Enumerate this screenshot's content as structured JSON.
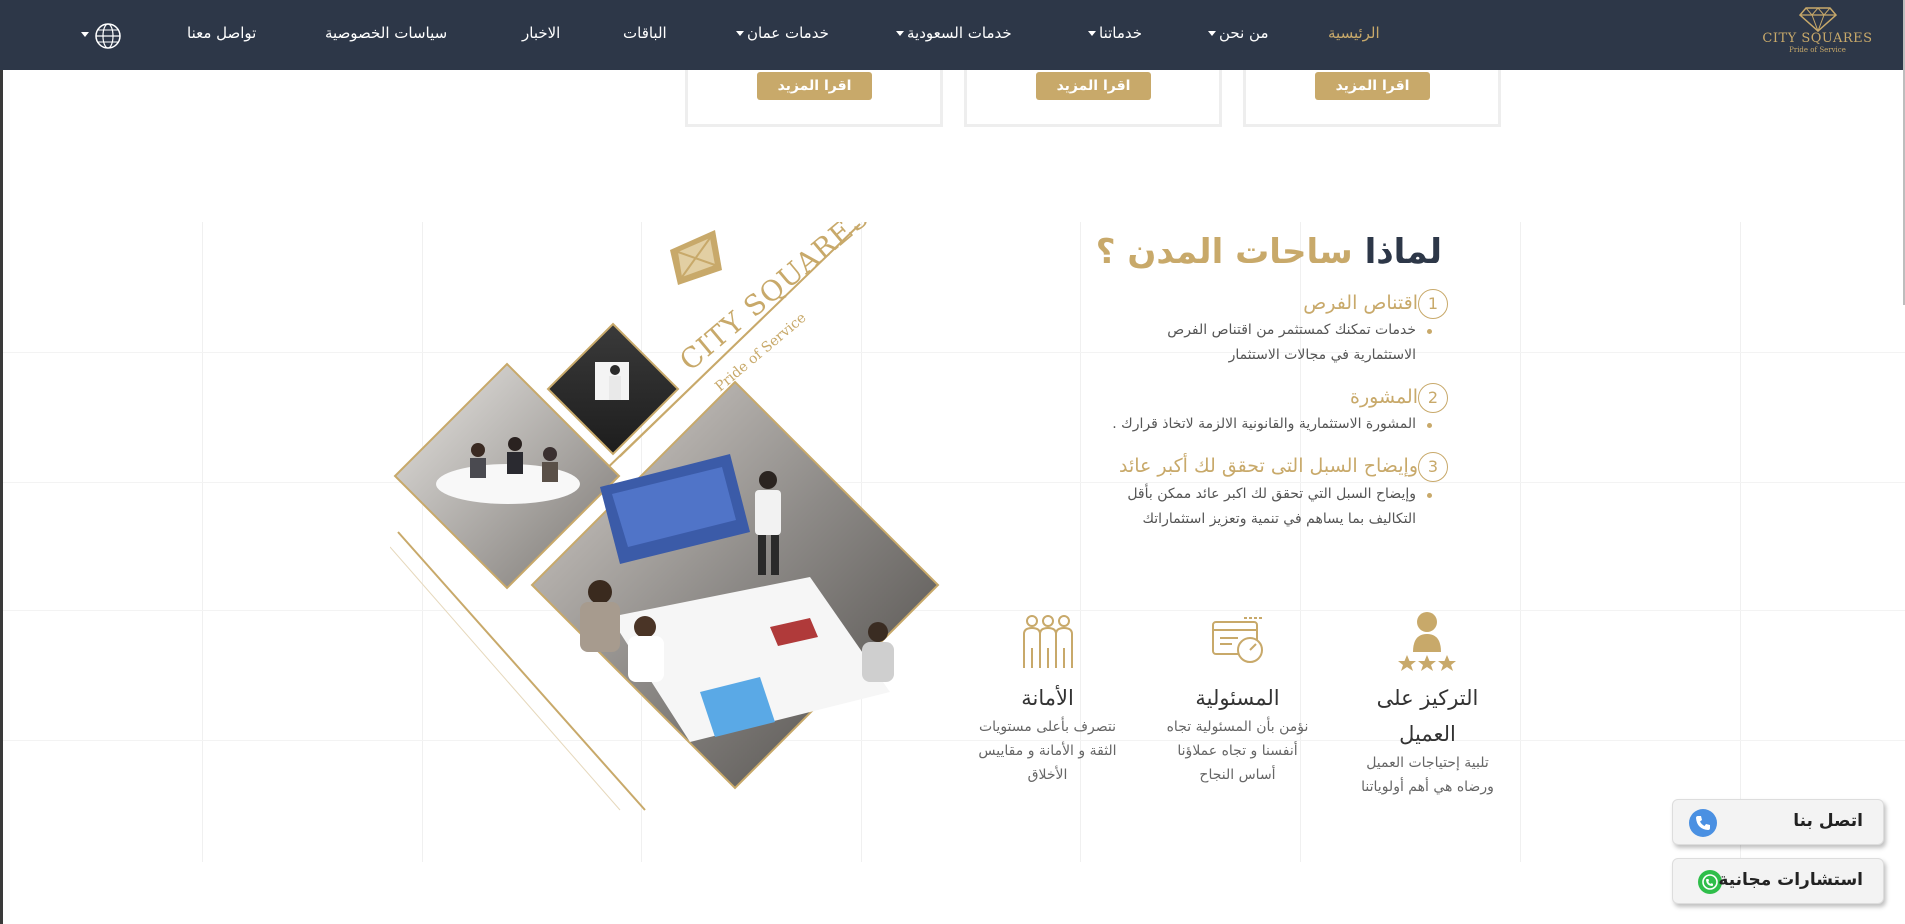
{
  "brand": {
    "logo_title": "CITY SQUARES",
    "logo_subtitle": "Pride of Service",
    "gold": "#c8a96a",
    "navy": "#2d3748"
  },
  "nav": {
    "items": [
      {
        "label": "الرئيسية",
        "active": true
      },
      {
        "label": "من نحن",
        "dropdown": true
      },
      {
        "label": "خدماتنا",
        "dropdown": true
      },
      {
        "label": "خدمات السعودية",
        "dropdown": true
      },
      {
        "label": "خدمات عمان",
        "dropdown": true
      },
      {
        "label": "الباقات"
      },
      {
        "label": "الاخبار"
      },
      {
        "label": "سياسات الخصوصية"
      },
      {
        "label": "تواصل معنا"
      }
    ],
    "language_icon": "globe-icon"
  },
  "cards": {
    "read_more": "اقرا المزيد"
  },
  "why": {
    "title_prefix": "لماذا",
    "title_highlight": "ساحات المدن ؟",
    "points": [
      {
        "number": "1",
        "title": "اقتناص الفرص",
        "text_line1": "خدمات تمكنك كمستثمر من اقتناص الفرص",
        "text_line2": "الاستثمارية في مجالات الاستثمار"
      },
      {
        "number": "2",
        "title": "المشورة",
        "text_line1": "المشورة الاستثمارية والقانونية الالزمة لاتخاذ قرارك .",
        "text_line2": ""
      },
      {
        "number": "3",
        "title": "وإيضاح السبل التى تحقق لك أكبر عائد",
        "text_line1": "وإيضاح السبل التي تحقق لك اكبر عائد ممكن بأقل",
        "text_line2": "التكاليف بما يساهم في تنمية وتعزيز استثماراتك"
      }
    ]
  },
  "collage": {
    "logo_text": "CITY SQUARES",
    "logo_sub": "Pride of Service"
  },
  "features": [
    {
      "icon": "customer-rating-icon",
      "title_line1": "التركيز على",
      "title_line2": "العميل",
      "text_line1": "تلبية إحتياجات العميل",
      "text_line2": "ورضاه هي أهم أولوياتنا",
      "text_line3": ""
    },
    {
      "icon": "responsibility-speed-icon",
      "title_line1": "المسئولية",
      "title_line2": "",
      "text_line1": "نؤمن بأن المسئولية تجاه",
      "text_line2": "أنفسنا و تجاه عملاؤنا",
      "text_line3": "أساس النجاح"
    },
    {
      "icon": "team-trust-icon",
      "title_line1": "الأمانة",
      "title_line2": "",
      "text_line1": "نتصرف بأعلى مستويات",
      "text_line2": "الثقة و الأمانة و مقاييس",
      "text_line3": "الأخلاق"
    }
  ],
  "floating": {
    "call_label": "اتصل بنا",
    "call_icon": "phone-icon",
    "whatsapp_label": "استشارات مجانية",
    "whatsapp_icon": "whatsapp-icon"
  }
}
